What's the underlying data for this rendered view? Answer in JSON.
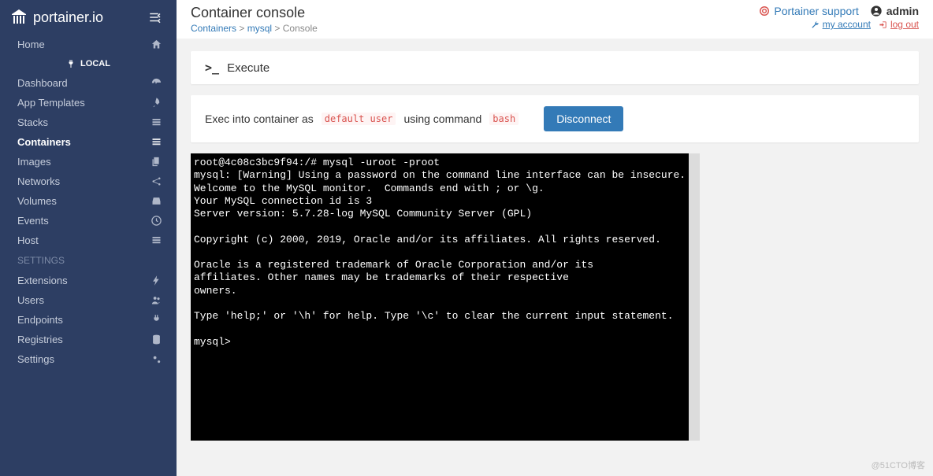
{
  "brand": "portainer.io",
  "sidebar": {
    "items": [
      {
        "label": "Home",
        "icon": "home-icon"
      }
    ],
    "endpoint_label": "LOCAL",
    "local_items": [
      {
        "label": "Dashboard",
        "icon": "dashboard-icon"
      },
      {
        "label": "App Templates",
        "icon": "rocket-icon"
      },
      {
        "label": "Stacks",
        "icon": "list-icon"
      },
      {
        "label": "Containers",
        "icon": "box-icon",
        "active": true
      },
      {
        "label": "Images",
        "icon": "copy-icon"
      },
      {
        "label": "Networks",
        "icon": "share-icon"
      },
      {
        "label": "Volumes",
        "icon": "hdd-icon"
      },
      {
        "label": "Events",
        "icon": "history-icon"
      },
      {
        "label": "Host",
        "icon": "list-icon"
      }
    ],
    "settings_header": "SETTINGS",
    "settings_items": [
      {
        "label": "Extensions",
        "icon": "bolt-icon"
      },
      {
        "label": "Users",
        "icon": "users-icon"
      },
      {
        "label": "Endpoints",
        "icon": "plug-icon"
      },
      {
        "label": "Registries",
        "icon": "database-icon"
      },
      {
        "label": "Settings",
        "icon": "cogs-icon"
      }
    ]
  },
  "header": {
    "title": "Container console",
    "breadcrumb": {
      "a": "Containers",
      "b": "mysql",
      "c": "Console"
    },
    "support": "Portainer support",
    "admin": "admin",
    "my_account": "my account",
    "logout": "log out"
  },
  "execute_panel": {
    "prompt_prefix": ">_",
    "title": "Execute"
  },
  "exec_bar": {
    "pre": "Exec into container as",
    "user": "default user",
    "mid": "using command",
    "cmd": "bash",
    "disconnect": "Disconnect"
  },
  "terminal": "root@4c08c3bc9f94:/# mysql -uroot -proot\nmysql: [Warning] Using a password on the command line interface can be insecure.\nWelcome to the MySQL monitor.  Commands end with ; or \\g.\nYour MySQL connection id is 3\nServer version: 5.7.28-log MySQL Community Server (GPL)\n\nCopyright (c) 2000, 2019, Oracle and/or its affiliates. All rights reserved.\n\nOracle is a registered trademark of Oracle Corporation and/or its\naffiliates. Other names may be trademarks of their respective\nowners.\n\nType 'help;' or '\\h' for help. Type '\\c' to clear the current input statement.\n\nmysql>",
  "watermark": "@51CTO博客"
}
